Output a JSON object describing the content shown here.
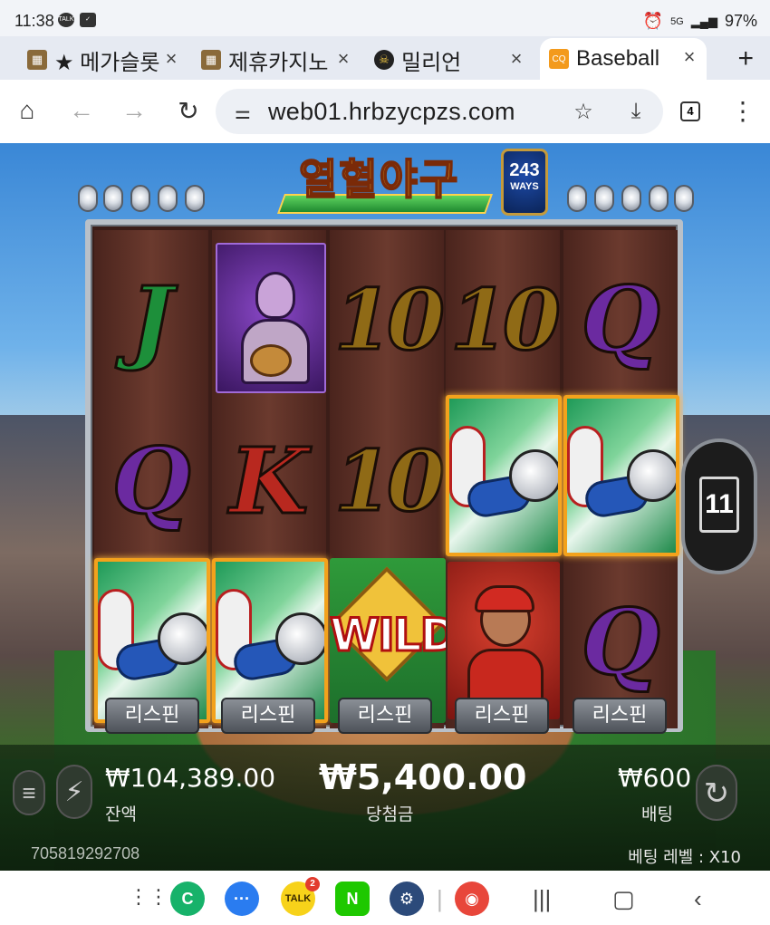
{
  "status": {
    "time": "11:38",
    "battery": "97%",
    "right_icons": [
      "alarm-icon",
      "5g-icon",
      "signal-icon"
    ]
  },
  "tabs": [
    {
      "title": "★ 메가슬롯",
      "icon": "slot-icon"
    },
    {
      "title": "제휴카지노",
      "icon": "slot-icon"
    },
    {
      "title": "밀리언",
      "icon": "pirate-icon"
    },
    {
      "title": "Baseball",
      "icon": "cq9-icon",
      "active": true
    }
  ],
  "browser": {
    "url": "web01.hrbzycpzs.com",
    "tab_count": "4"
  },
  "game": {
    "title": "열혈야구",
    "ways_number": "243",
    "ways_label": "WAYS",
    "reels": [
      [
        "J",
        "Q",
        "PITCH"
      ],
      [
        "CATCHER",
        "K",
        "PITCH"
      ],
      [
        "10",
        "10",
        "WILD"
      ],
      [
        "10",
        "PITCH",
        "BATTER"
      ],
      [
        "Q",
        "PITCH",
        "Q"
      ]
    ],
    "wild_label": "WILD",
    "respin_label": "리스핀",
    "respin_buttons": [
      "리스핀",
      "리스핀",
      "리스핀",
      "리스핀",
      "리스핀"
    ],
    "multiplier": "11",
    "balance_value": "₩104,389.00",
    "balance_label": "잔액",
    "win_value": "₩5,400.00",
    "win_label": "당첨금",
    "bet_value": "₩600",
    "bet_label": "배팅",
    "game_id": "705819292708",
    "bet_level": "베팅 레벨 : X10"
  },
  "navbar": {
    "apps": [
      "phone-app-icon",
      "messages-icon",
      "kakaotalk-icon",
      "naver-icon",
      "settings-icon",
      "red-app-icon"
    ],
    "kakao_badge": "2"
  }
}
